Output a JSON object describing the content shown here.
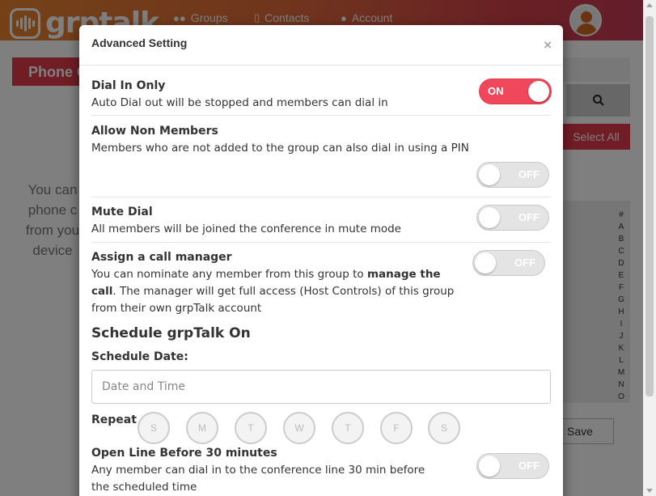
{
  "app": {
    "logo_text": "grptalk"
  },
  "nav": {
    "groups": "Groups",
    "contacts": "Contacts",
    "account": "Account"
  },
  "page": {
    "phone_tab": "Phone C",
    "left_text": "You can phone c from you device",
    "select_all": "Select All",
    "alphabet": [
      "#",
      "A",
      "B",
      "C",
      "D",
      "E",
      "F",
      "G",
      "H",
      "I",
      "J",
      "K",
      "L",
      "M",
      "N",
      "O"
    ],
    "save_label": "Save"
  },
  "modal": {
    "title": "Advanced Setting",
    "close": "×",
    "dial_in_only": {
      "title": "Dial In Only",
      "desc": "Auto Dial out will be stopped and members can dial in",
      "state": "ON",
      "on": true
    },
    "allow_non_members": {
      "title": "Allow Non Members",
      "desc": "Members who are not added to the group can also dial in using a PIN",
      "state": "OFF",
      "on": false
    },
    "mute_dial": {
      "title": "Mute Dial",
      "desc": "All members will be joined the conference in mute mode",
      "state": "OFF",
      "on": false
    },
    "call_manager": {
      "title": "Assign a call manager",
      "desc_part1": "You can nominate any member from this group to ",
      "desc_bold": "manage the call",
      "desc_part2": ". The manager will get full access (Host Controls) of this group from their own grpTalk account",
      "state": "OFF",
      "on": false
    },
    "schedule": {
      "title": "Schedule grpTalk On",
      "date_label": "Schedule Date:",
      "date_placeholder": "Date and Time",
      "repeat_label": "Repeat",
      "days": [
        "S",
        "M",
        "T",
        "W",
        "T",
        "F",
        "S"
      ]
    },
    "open_line": {
      "title": "Open Line Before 30 minutes",
      "desc": "Any member can dial in to the conference line 30 min before the scheduled time",
      "state": "OFF",
      "on": false
    }
  },
  "colors": {
    "accent": "#e03b4b",
    "toggle_on": "#f0475a",
    "toggle_off": "#e4e4e4"
  }
}
